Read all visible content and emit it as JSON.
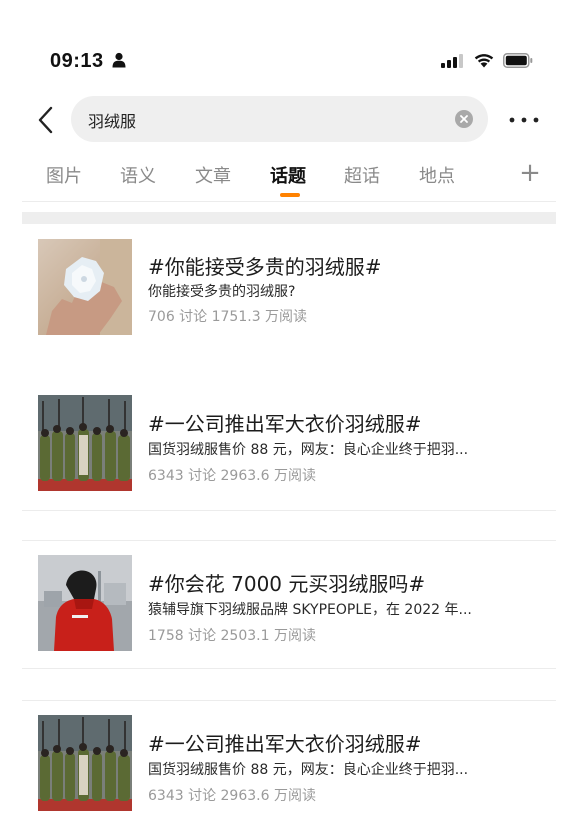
{
  "status_bar": {
    "time": "09:13"
  },
  "search": {
    "query": "羽绒服"
  },
  "tabs": [
    {
      "label": "图片"
    },
    {
      "label": "语义"
    },
    {
      "label": "文章"
    },
    {
      "label": "话题"
    },
    {
      "label": "超话"
    },
    {
      "label": "地点"
    }
  ],
  "active_tab": "话题",
  "accent_color": "#ff8200",
  "results": [
    {
      "title": "#你能接受多贵的羽绒服#",
      "description": "你能接受多贵的羽绒服?",
      "stats": "706 讨论 1751.3 万阅读"
    },
    {
      "title": "#一公司推出军大衣价羽绒服#",
      "description": "国货羽绒服售价 88 元，网友：良心企业终于把羽...",
      "stats": "6343 讨论 2963.6 万阅读"
    },
    {
      "title": "#你会花 7000 元买羽绒服吗#",
      "description": "猿辅导旗下羽绒服品牌 SKYPEOPLE，在 2022 年...",
      "stats": "1758 讨论 2503.1 万阅读"
    },
    {
      "title": "#一公司推出军大衣价羽绒服#",
      "description": "国货羽绒服售价 88 元，网友：良心企业终于把羽...",
      "stats": "6343 讨论 2963.6 万阅读"
    }
  ]
}
